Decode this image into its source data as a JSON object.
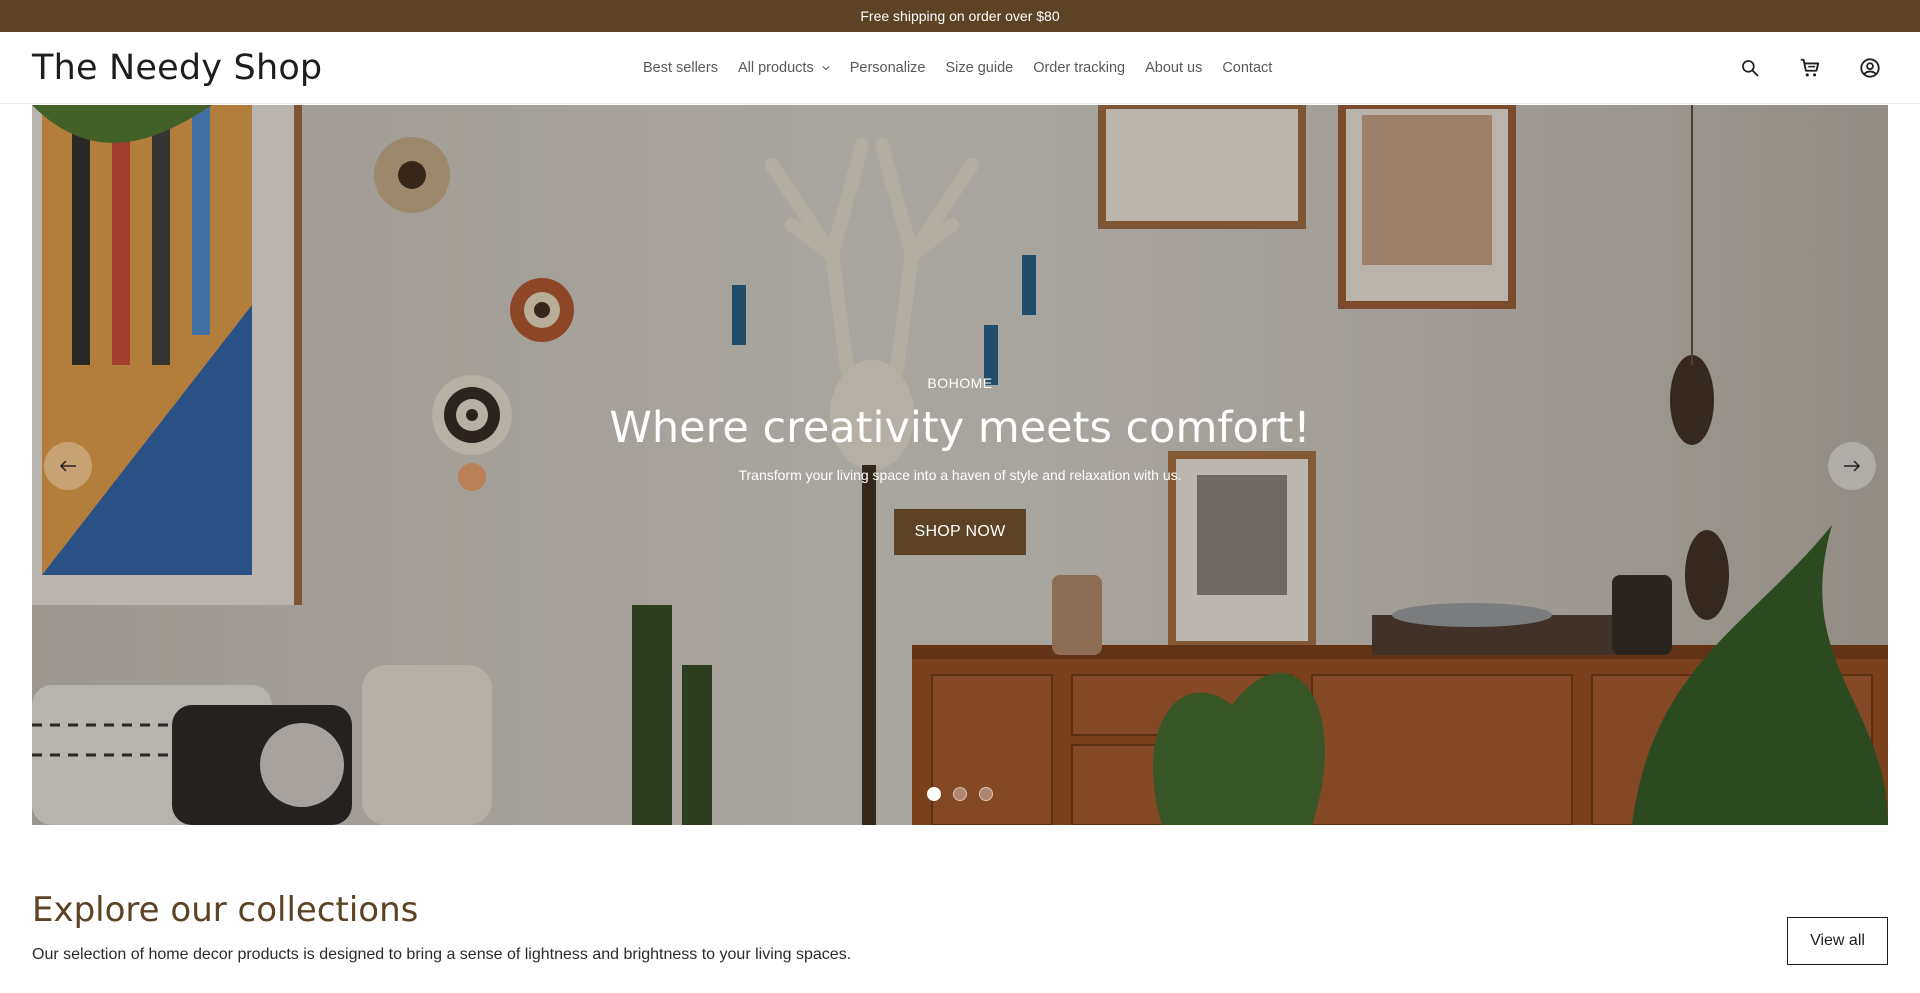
{
  "announcement": {
    "text": "Free shipping on order over $80"
  },
  "header": {
    "logo": "The Needy Shop",
    "nav": [
      {
        "label": "Best sellers"
      },
      {
        "label": "All products",
        "has_dropdown": true
      },
      {
        "label": "Personalize"
      },
      {
        "label": "Size guide"
      },
      {
        "label": "Order tracking"
      },
      {
        "label": "About us"
      },
      {
        "label": "Contact"
      }
    ],
    "icons": [
      "search-icon",
      "cart-icon",
      "account-icon"
    ]
  },
  "hero": {
    "eyebrow": "BOHOME",
    "title": "Where creativity meets comfort!",
    "subtitle": "Transform your living space into a haven of style and relaxation with us.",
    "cta_label": "SHOP NOW",
    "slide_count": 3,
    "active_slide": 1
  },
  "collections": {
    "title": "Explore our collections",
    "description": "Our selection of home decor products is designed to bring a sense of lightness and brightness to your living spaces.",
    "view_all_label": "View all"
  },
  "colors": {
    "brand_brown": "#5c4324",
    "text_dark": "#1e1e1e",
    "white": "#ffffff"
  }
}
